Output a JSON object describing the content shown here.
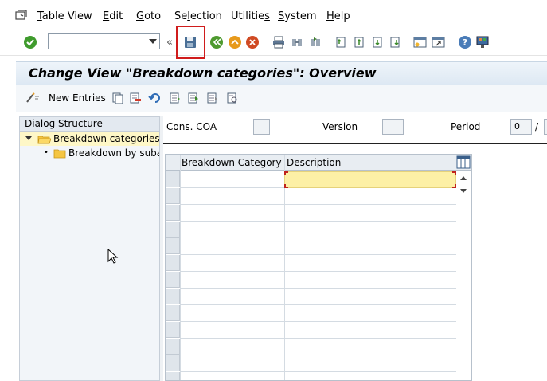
{
  "menu": [
    "Table View",
    "Edit",
    "Goto",
    "Selection",
    "Utilities",
    "System",
    "Help"
  ],
  "toolbar": {
    "command_value": "",
    "icons": [
      "check-icon",
      "save-icon",
      "back-icon",
      "exit-icon",
      "cancel-icon",
      "print-icon",
      "find-icon",
      "find-next-icon",
      "first-page-icon",
      "previous-page-icon",
      "next-page-icon",
      "last-page-icon",
      "new-session-icon",
      "shortcut-icon",
      "help-icon",
      "layout-icon"
    ]
  },
  "page_title": "Change View \"Breakdown categories\": Overview",
  "app_toolbar": {
    "new_entries_label": "New Entries"
  },
  "dialog_structure": {
    "header": "Dialog Structure",
    "items": [
      {
        "label": "Breakdown categories",
        "selected": true,
        "level": 0
      },
      {
        "label": "Breakdown by subas",
        "selected": false,
        "level": 1
      }
    ]
  },
  "fields": {
    "cons_coa_label": "Cons. COA",
    "cons_coa_value": "",
    "version_label": "Version",
    "version_value": "",
    "period_label": "Period",
    "period_value": "0",
    "period_sep": "/"
  },
  "table": {
    "columns": [
      "Breakdown Category",
      "Description"
    ],
    "row_count": 13
  },
  "colors": {
    "highlight": "#d01c1c",
    "title_bg": "#e6eef6",
    "selected_row": "#fef7c7",
    "input_cell": "#fdf0a6"
  }
}
